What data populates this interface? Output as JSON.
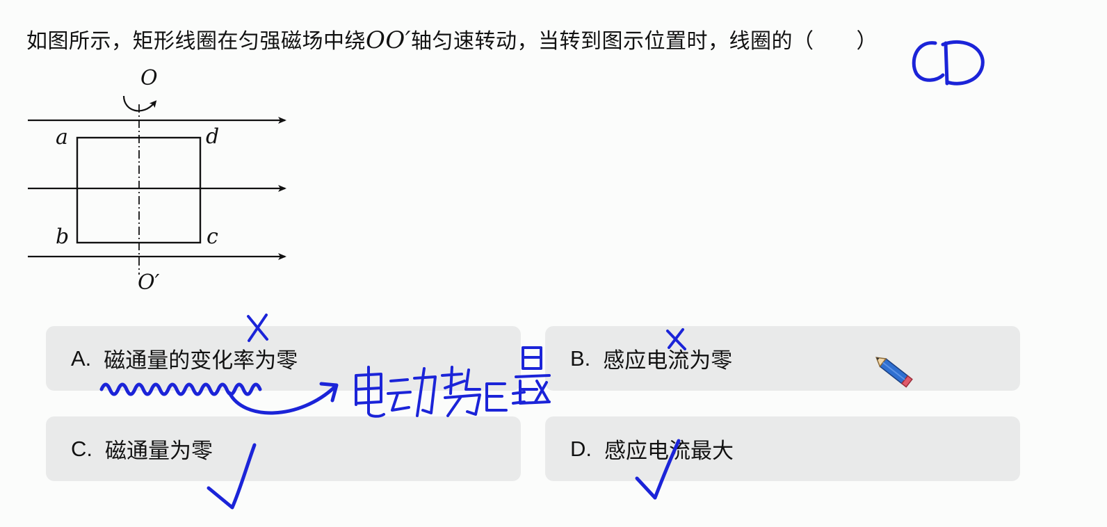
{
  "question": {
    "text_before": "如图所示，矩形线圈在匀强磁场中绕",
    "axis": "OO′",
    "text_after": "轴匀速转动，当转到图示位置时，线圈的（　　）"
  },
  "diagram": {
    "labels": {
      "O_top": "O",
      "O_bottom": "O′",
      "a": "a",
      "b": "b",
      "c": "c",
      "d": "d"
    }
  },
  "options": [
    {
      "letter": "A.",
      "text": "磁通量的变化率为零"
    },
    {
      "letter": "B.",
      "text": "感应电流为零"
    },
    {
      "letter": "C.",
      "text": "磁通量为零"
    },
    {
      "letter": "D.",
      "text": "感应电流最大"
    }
  ],
  "annotations": {
    "answer": "CD",
    "note": "电动势E=最"
  },
  "colors": {
    "ink": "#1b24d8",
    "option_bg": "#e9eaea",
    "page_bg": "#fbfcfb"
  },
  "icons": [
    "pencil-icon"
  ]
}
